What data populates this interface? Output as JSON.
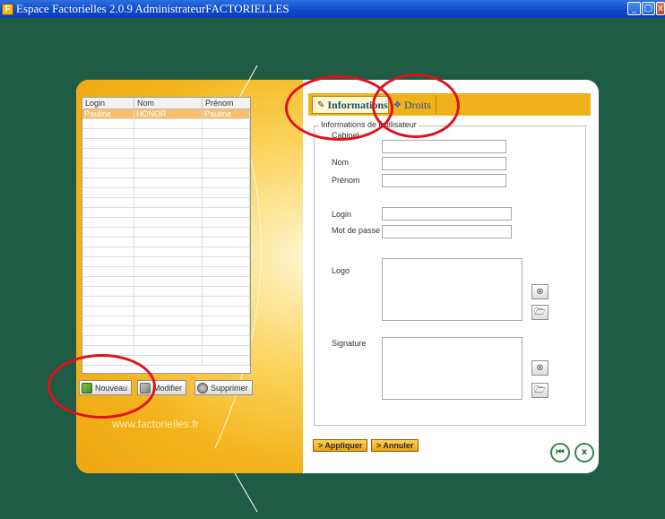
{
  "window": {
    "title": "Espace Factorielles 2.0.9  AdministrateurFACTORIELLES",
    "app_icon_glyph": "F",
    "controls": {
      "minimize": "_",
      "maximize": "□",
      "close": "x"
    }
  },
  "user_list": {
    "columns": [
      "Login",
      "Nom",
      "Prénom"
    ],
    "rows": [
      {
        "login": "Pauline",
        "nom": "HONOR",
        "prenom": "Pauline",
        "selected": true
      }
    ]
  },
  "list_buttons": {
    "new": "Nouveau",
    "edit": "Modifier",
    "delete": "Supprimer"
  },
  "website": "www.factorielles.fr",
  "tabs": {
    "informations": "Informations",
    "droits": "Droits"
  },
  "form": {
    "legend": "Informations de l'utilisateur",
    "cabinet_label": "Cabinet",
    "nom_label": "Nom",
    "prenom_label": "Prénom",
    "login_label": "Login",
    "password_label": "Mot de passe",
    "logo_label": "Logo",
    "signature_label": "Signature",
    "cabinet_value": "",
    "nom_value": "",
    "prenom_value": "",
    "login_value": "",
    "password_value": ""
  },
  "actions": {
    "apply": "> Appliquer",
    "cancel": "> Annuler",
    "back_icon": "back-icon",
    "excel_icon": "excel-icon"
  },
  "colors": {
    "background": "#1e5c45",
    "accent": "#efb11c",
    "annotation": "#e3101c"
  }
}
